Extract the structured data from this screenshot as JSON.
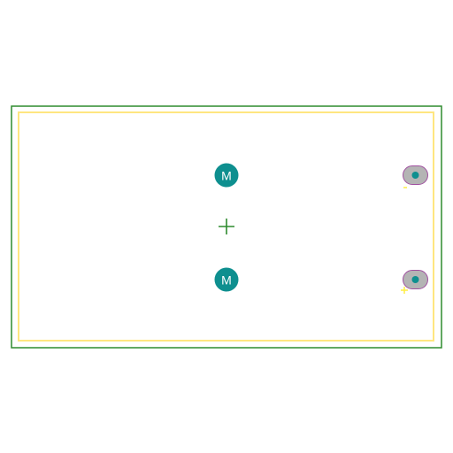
{
  "colors": {
    "background": "#ffffff",
    "board_outline": "#2e8b2e",
    "silkscreen": "#ffe680",
    "mounting_pad": "#0e8f8f",
    "pad_body": "#b4b4b4",
    "pad_outline": "#a050a0",
    "pad_hole": "#0e8f8f",
    "origin_marker": "#2e8b2e",
    "polarity_marker": "#ffee44",
    "pad_text": "#ffffff"
  },
  "footprint": {
    "mounting_pads": [
      {
        "label": "M"
      },
      {
        "label": "M"
      }
    ],
    "terminal_pads": [
      {
        "polarity": "-"
      },
      {
        "polarity": "+"
      }
    ]
  },
  "icons": {
    "origin": "crosshair-icon"
  }
}
